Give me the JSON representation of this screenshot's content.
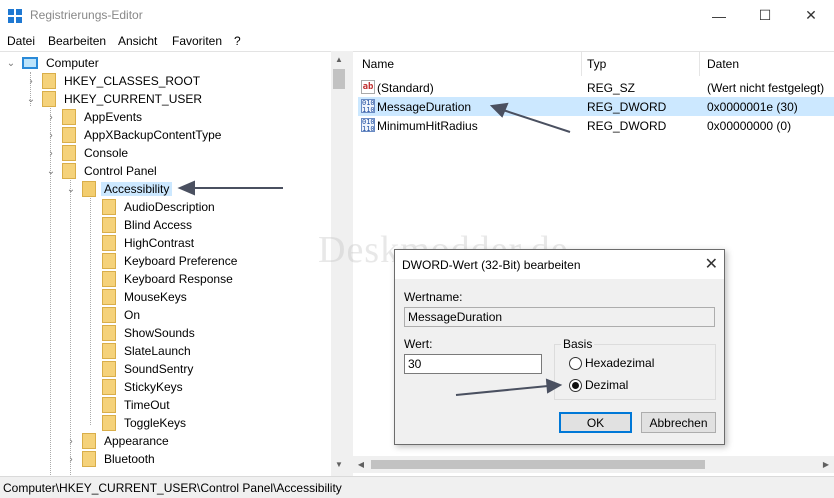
{
  "window": {
    "title": "Registrierungs-Editor",
    "minimize_glyph": "—",
    "maximize_glyph": "☐",
    "close_glyph": "✕"
  },
  "menu": [
    "Datei",
    "Bearbeiten",
    "Ansicht",
    "Favoriten",
    "?"
  ],
  "tree": {
    "root": "Computer",
    "hkcr": "HKEY_CLASSES_ROOT",
    "hkcu": "HKEY_CURRENT_USER",
    "hkcu_children": [
      "AppEvents",
      "AppXBackupContentType",
      "Console",
      "Control Panel"
    ],
    "control_panel_children_before": [
      "Accessibility"
    ],
    "accessibility_children": [
      "AudioDescription",
      "Blind Access",
      "HighContrast",
      "Keyboard Preference",
      "Keyboard Response",
      "MouseKeys",
      "On",
      "ShowSounds",
      "SlateLaunch",
      "SoundSentry",
      "StickyKeys",
      "TimeOut",
      "ToggleKeys"
    ],
    "control_panel_children_after": [
      "Appearance",
      "Bluetooth"
    ],
    "selected": "Accessibility"
  },
  "list": {
    "columns": [
      "Name",
      "Typ",
      "Daten"
    ],
    "rows": [
      {
        "name": "(Standard)",
        "type": "REG_SZ",
        "data": "(Wert nicht festgelegt)",
        "icon": "string-value-icon"
      },
      {
        "name": "MessageDuration",
        "type": "REG_DWORD",
        "data": "0x0000001e (30)",
        "icon": "dword-value-icon"
      },
      {
        "name": "MinimumHitRadius",
        "type": "REG_DWORD",
        "data": "0x00000000 (0)",
        "icon": "dword-value-icon"
      }
    ],
    "selected_row": "MessageDuration"
  },
  "status": "Computer\\HKEY_CURRENT_USER\\Control Panel\\Accessibility",
  "watermark": "Deskmodder.de",
  "dialog": {
    "title": "DWORD-Wert (32-Bit) bearbeiten",
    "name_label": "Wertname:",
    "name_value": "MessageDuration",
    "value_label": "Wert:",
    "value_value": "30",
    "base_label": "Basis",
    "hex_label": "Hexadezimal",
    "dec_label": "Dezimal",
    "selected_base": "Dezimal",
    "ok_label": "OK",
    "cancel_label": "Abbrechen"
  },
  "colors": {
    "selection": "#cce8ff",
    "accent": "#0078d7",
    "folder": "#f5d27a",
    "annotation_arrow": "#4a5060"
  }
}
